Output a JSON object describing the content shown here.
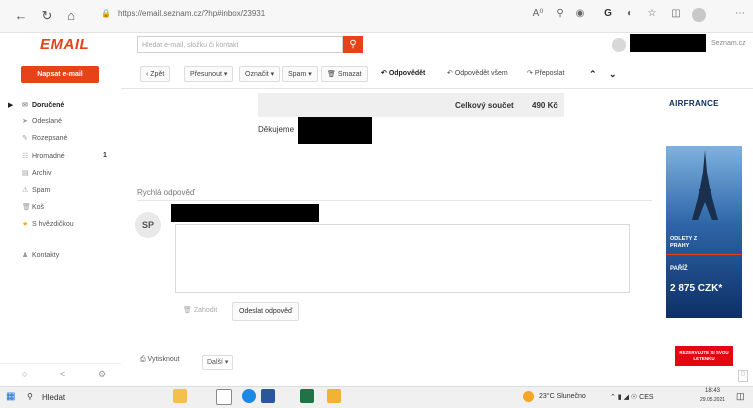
{
  "browser": {
    "url": "https://email.seznam.cz/?hp#inbox/23931",
    "nav_icons": [
      "back-icon",
      "reload-icon",
      "home-icon"
    ]
  },
  "app": {
    "logo_text": "EMAIL",
    "search_placeholder": "Hledat e-mail, složku či kontakt",
    "brand_link": "Seznam.cz"
  },
  "sidebar": {
    "compose_label": "Napsat e-mail",
    "items": [
      {
        "label": "Doručené",
        "icon": "inbox-icon"
      },
      {
        "label": "Odeslané",
        "icon": "sent-icon"
      },
      {
        "label": "Rozepsané",
        "icon": "drafts-icon"
      },
      {
        "label": "Hromadné",
        "icon": "bulk-icon",
        "count": "1"
      },
      {
        "label": "Archiv",
        "icon": "archive-icon"
      },
      {
        "label": "Spam",
        "icon": "spam-icon"
      },
      {
        "label": "Koš",
        "icon": "trash-icon"
      },
      {
        "label": "S hvězdičkou",
        "icon": "star-icon"
      }
    ],
    "contacts_label": "Kontakty"
  },
  "toolbar": {
    "back": "‹ Zpět",
    "move": "Přesunout ▾",
    "mark": "Označit ▾",
    "spam": "Spam ▾",
    "delete": "Smazat",
    "reply": "Odpovědět",
    "reply_all": "Odpovědět všem",
    "forward": "Přeposlat"
  },
  "email": {
    "total_label": "Celkový součet",
    "total_value": "490 Kč",
    "thanks": "Děkujeme"
  },
  "quick_reply": {
    "heading": "Rychlá odpověď",
    "avatar": "SP",
    "discard": "Zahodit",
    "send": "Odeslat odpověď"
  },
  "footer_actions": {
    "print": "Vytisknout",
    "more": "Další ▾"
  },
  "ad": {
    "logo": "AIRFRANCE",
    "line1": "ODLETY Z",
    "line2": "PRAHY",
    "dest": "PAŘÍŽ",
    "price": "2 875 CZK*",
    "cta": "REZERVUJTE SI SVOU LETENKU"
  },
  "taskbar": {
    "search": "Hledat",
    "weather": "23°C Slunečno",
    "tray": "CES",
    "time": "18:43",
    "date": "29.05.2021"
  },
  "colors": {
    "accent": "#e8421a",
    "airfrance_red": "#e30613"
  }
}
